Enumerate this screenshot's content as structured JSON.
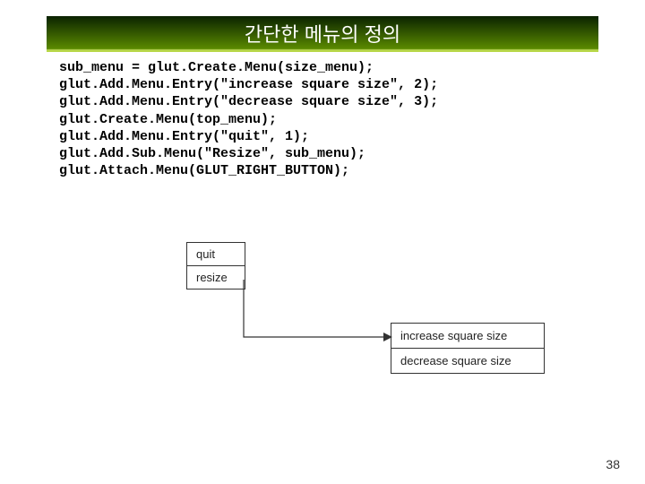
{
  "title": "간단한 메뉴의 정의",
  "code": [
    "sub_menu = glut.Create.Menu(size_menu);",
    "glut.Add.Menu.Entry(\"increase square size\", 2);",
    "glut.Add.Menu.Entry(\"decrease square size\", 3);",
    "glut.Create.Menu(top_menu);",
    "glut.Add.Menu.Entry(\"quit\", 1);",
    "glut.Add.Sub.Menu(\"Resize\", sub_menu);",
    "glut.Attach.Menu(GLUT_RIGHT_BUTTON);"
  ],
  "menu": {
    "main": [
      "quit",
      "resize"
    ],
    "sub": [
      "increase square size",
      "decrease square size"
    ]
  },
  "page_number": "38"
}
